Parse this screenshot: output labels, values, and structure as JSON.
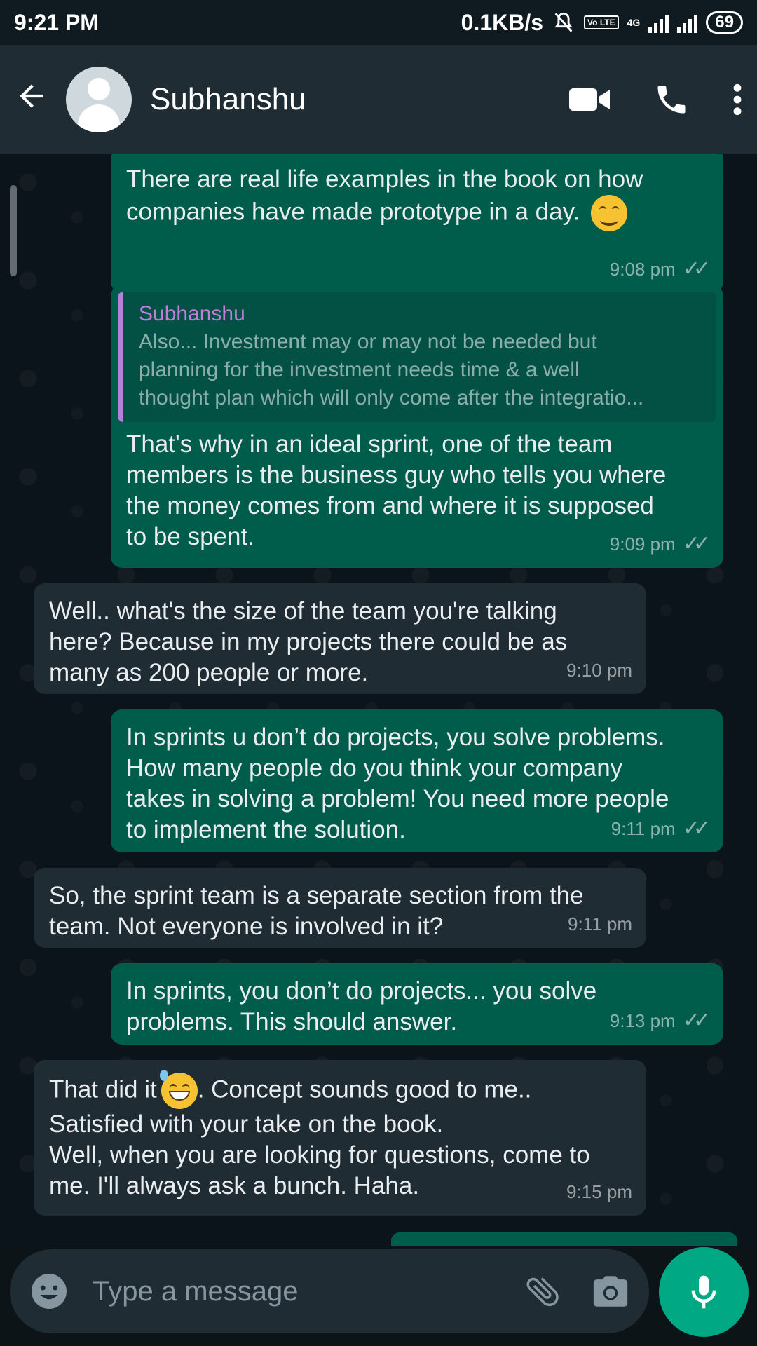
{
  "status_bar": {
    "time": "9:21 PM",
    "net_speed": "0.1KB/s",
    "network_label": "4G",
    "volte_label": "Vo LTE",
    "battery": "69"
  },
  "header": {
    "contact_name": "Subhanshu",
    "icons": [
      "back-arrow-icon",
      "avatar",
      "video-call-icon",
      "phone-icon",
      "more-vert-icon"
    ]
  },
  "messages": [
    {
      "direction": "out",
      "text_line1": "There are real life examples in the book on how",
      "text_line2": "companies have made prototype in a day.",
      "time": "9:08 pm",
      "emoji": "smiling-face-emoji"
    },
    {
      "direction": "out",
      "quote_author": "Subhanshu",
      "quote_line1": "Also... Investment may or may not be needed but",
      "quote_line2": "planning for the investment needs time & a well",
      "quote_line3": "thought plan which will only come after the integratio...",
      "line1": "That's why in an ideal sprint, one of the team",
      "line2": "members is the business guy who tells you where",
      "line3": "the money comes from and where it is supposed",
      "line4": "to be spent.",
      "time": "9:09 pm"
    },
    {
      "direction": "in",
      "line1": "Well.. what's the size of the team you're talking",
      "line2": "here? Because in my projects there could be as",
      "line3": "many as 200 people or more.",
      "time": "9:10 pm"
    },
    {
      "direction": "out",
      "line1": "In sprints u don’t do projects, you solve problems.",
      "line2": "How many people do you think your company",
      "line3": "takes in solving a problem! You need more people",
      "line4": "to implement the solution.",
      "time": "9:11 pm"
    },
    {
      "direction": "in",
      "line1": "So, the sprint team is a separate section from the",
      "line2": "team. Not everyone is involved in it?",
      "time": "9:11 pm"
    },
    {
      "direction": "out",
      "line1": "In sprints, you don’t do projects... you solve",
      "line2": "problems. This should answer.",
      "time": "9:13 pm"
    },
    {
      "direction": "in",
      "line1_a": "That did it",
      "line1_b": ". Concept sounds good to me..",
      "line2": "Satisfied with your take on the book.",
      "line3": "Well, when you are looking for questions, come to",
      "line4": "me. I'll always ask a bunch. Haha.",
      "time": "9:15 pm",
      "emoji": "grinning-sweat-emoji"
    }
  ],
  "composer": {
    "placeholder": "Type a message",
    "icons": [
      "emoji-icon",
      "attach-icon",
      "camera-icon",
      "mic-icon"
    ]
  },
  "colors": {
    "outgoing_bubble": "#005c4b",
    "incoming_bubble": "#202c33",
    "header": "#1f2c34",
    "accent": "#00a884",
    "quote_author": "#c07fdd"
  }
}
